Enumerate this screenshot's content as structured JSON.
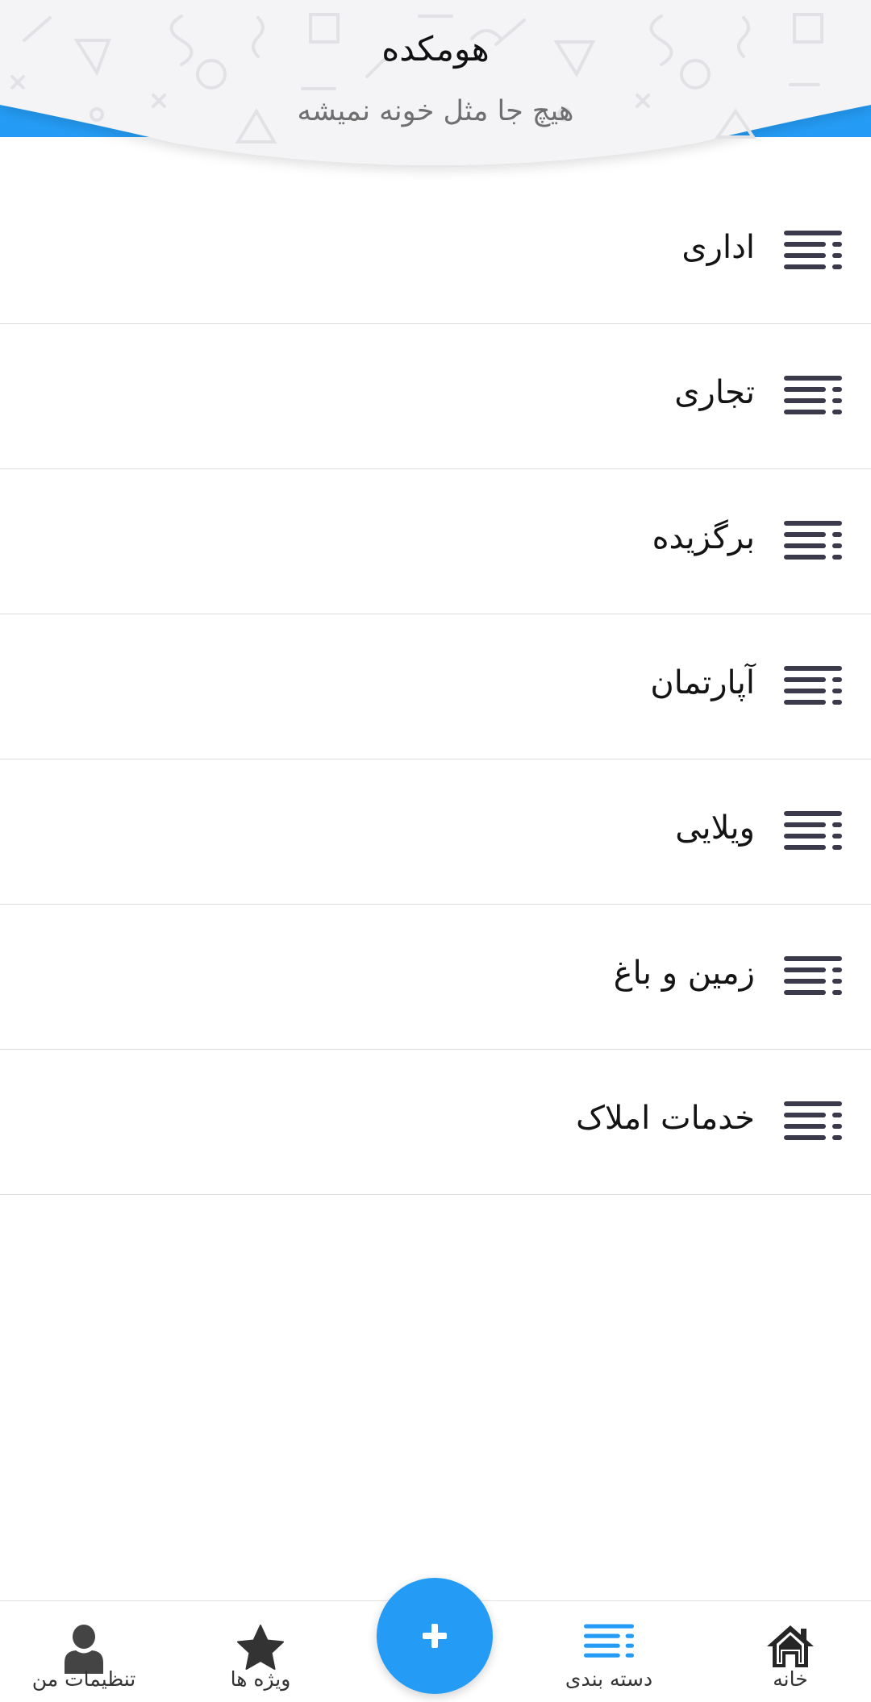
{
  "header": {
    "title": "هومکده",
    "subtitle": "هیچ جا مثل خونه نمیشه"
  },
  "colors": {
    "accent": "#249cf5",
    "icon_dark": "#3a3a4a",
    "divider": "#dcdcdc"
  },
  "categories": [
    {
      "label": "اداری",
      "icon": "list-icon"
    },
    {
      "label": "تجاری",
      "icon": "list-icon"
    },
    {
      "label": "برگزیده",
      "icon": "list-icon"
    },
    {
      "label": "آپارتمان",
      "icon": "list-icon"
    },
    {
      "label": "ویلایی",
      "icon": "list-icon"
    },
    {
      "label": "زمین و باغ",
      "icon": "list-icon"
    },
    {
      "label": "خدمات املاک",
      "icon": "list-icon"
    }
  ],
  "bottom_nav": {
    "home": {
      "label": "خانه",
      "icon": "home-icon"
    },
    "category": {
      "label": "دسته بندی",
      "icon": "list-icon",
      "active": true
    },
    "add": {
      "icon": "plus-icon"
    },
    "featured": {
      "label": "ویژه ها",
      "icon": "star-icon"
    },
    "settings": {
      "label": "تنظیمات من",
      "icon": "user-icon"
    }
  }
}
